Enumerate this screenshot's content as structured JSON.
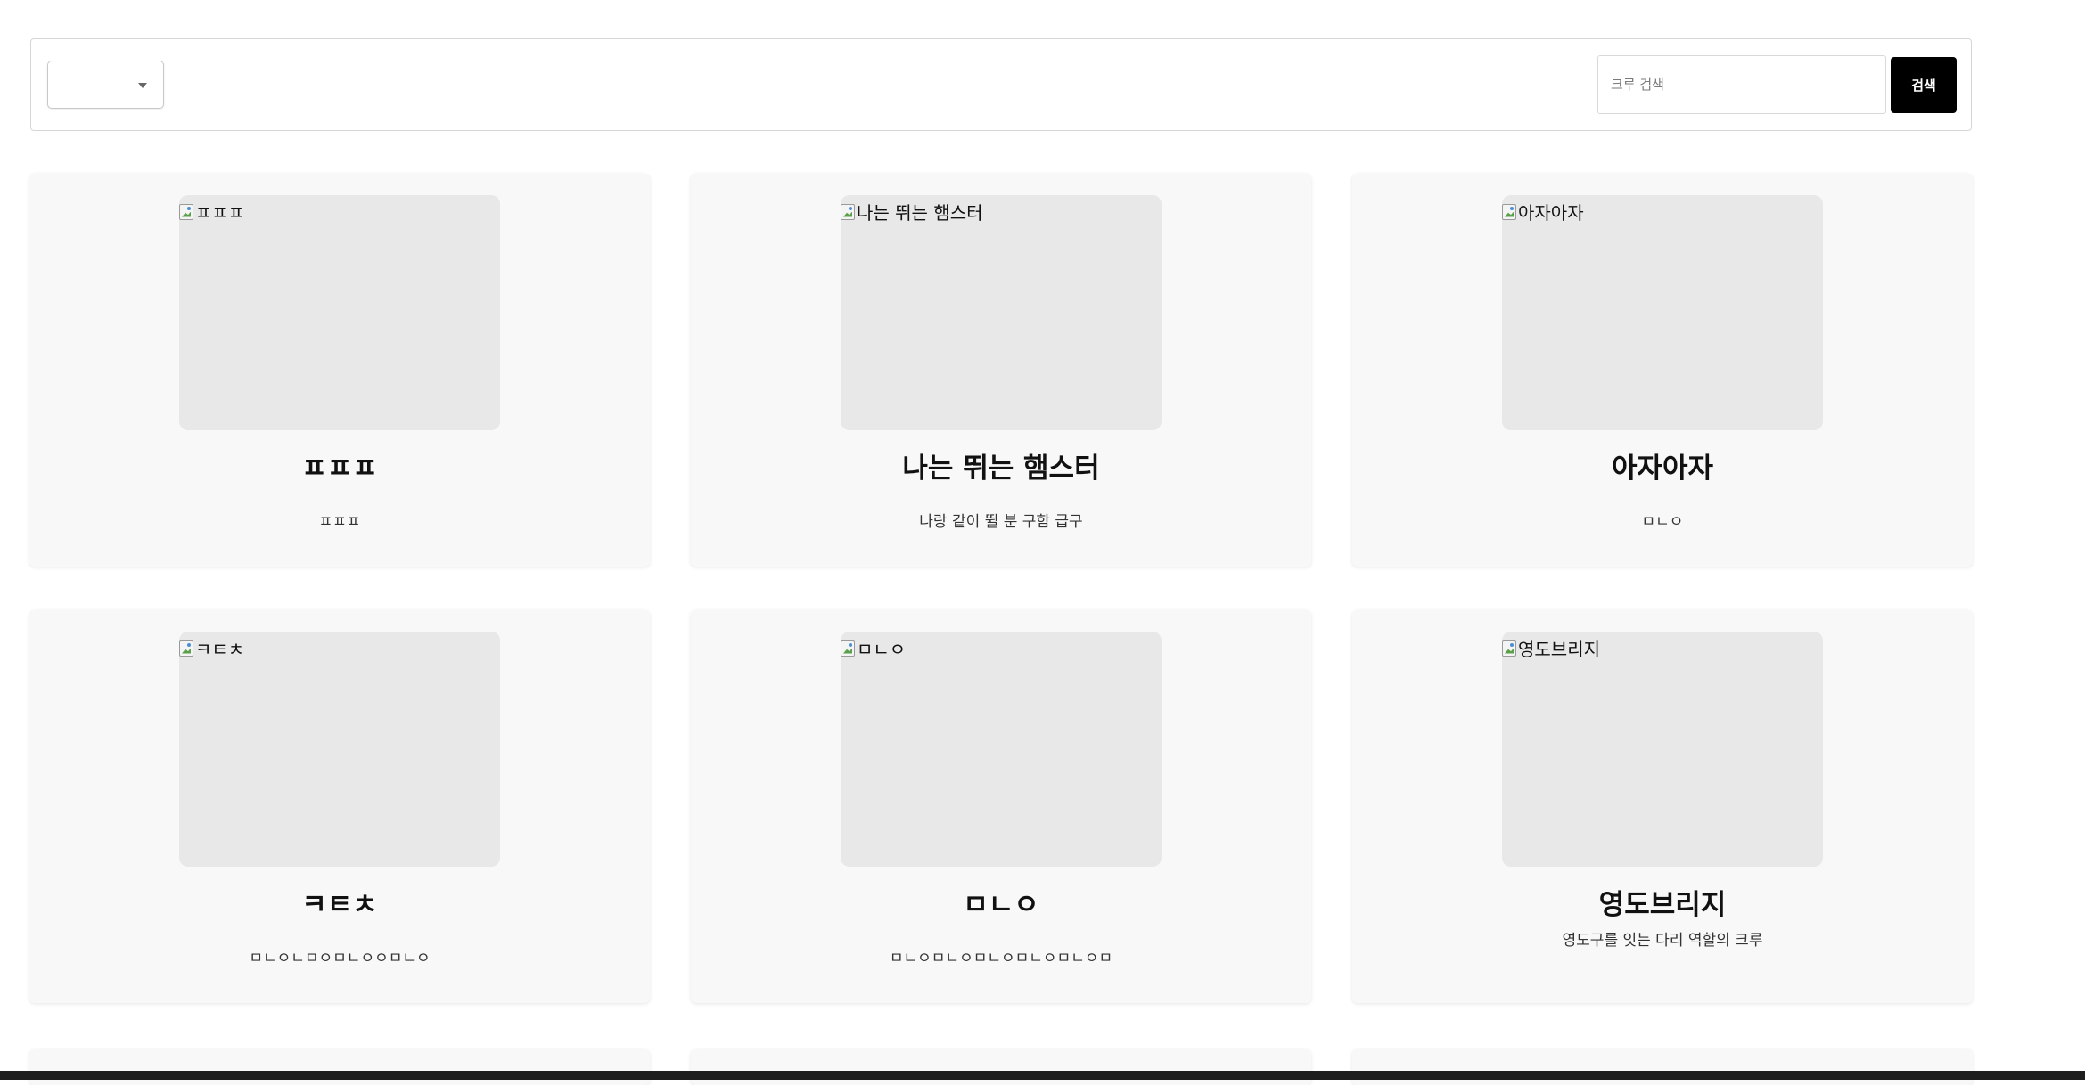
{
  "filter": {
    "selected_value": ""
  },
  "search": {
    "placeholder": "크루 검색",
    "button_label": "검색"
  },
  "crews": [
    {
      "image_alt": "ㅍㅍㅍ",
      "title": "ㅍㅍㅍ",
      "description": "ㅍㅍㅍ"
    },
    {
      "image_alt": "나는 뛰는 햄스터",
      "title": "나는 뛰는 햄스터",
      "description": "나랑 같이 뛸 분 구함 급구"
    },
    {
      "image_alt": "아자아자",
      "title": "아자아자",
      "description": "ㅁㄴㅇ"
    },
    {
      "image_alt": "ㅋㅌㅊ",
      "title": "ㅋㅌㅊ",
      "description": "ㅁㄴㅇㄴㅁㅇㅁㄴㅇㅇㅁㄴㅇ"
    },
    {
      "image_alt": "ㅁㄴㅇ",
      "title": "ㅁㄴㅇ",
      "description": "ㅁㄴㅇㅁㄴㅇㅁㄴㅇㅁㄴㅇㅁㄴㅇㅁ"
    },
    {
      "image_alt": "영도브리지",
      "title": "영도브리지",
      "description": "영도구를 잇는 다리 역할의 크루"
    }
  ]
}
